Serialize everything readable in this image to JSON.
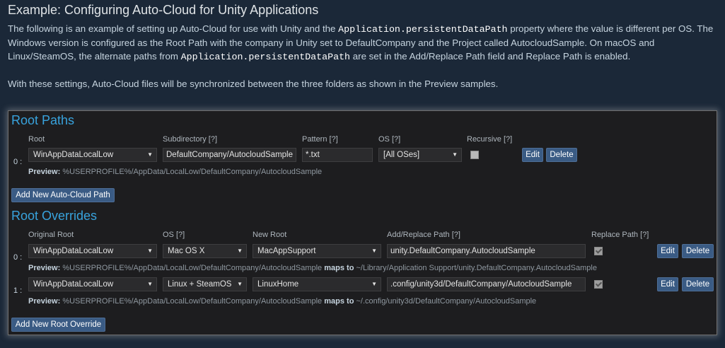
{
  "heading": "Example: Configuring Auto-Cloud for Unity Applications",
  "description": {
    "p1_part1": "The following is an example of setting up Auto-Cloud for use with Unity and the ",
    "p1_code1": "Application.persistentDataPath",
    "p1_part2": " property where the value is different per OS. The Windows version is configured as the Root Path with the company in Unity set to DefaultCompany and the Project called AutocloudSample. On macOS and Linux/SteamOS, the alternate paths from ",
    "p1_code2": "Application.persistentDataPath",
    "p1_part3": " are set in the Add/Replace Path field and Replace Path is enabled.",
    "p2": "With these settings, Auto-Cloud files will be synchronized between the three folders as shown in the Preview samples."
  },
  "root_paths": {
    "title": "Root Paths",
    "headers": {
      "root": "Root",
      "subdirectory": "Subdirectory [?]",
      "pattern": "Pattern [?]",
      "os": "OS [?]",
      "recursive": "Recursive [?]"
    },
    "rows": [
      {
        "index": "0 :",
        "root": "WinAppDataLocalLow",
        "subdirectory": "DefaultCompany/AutocloudSample",
        "pattern": "*.txt",
        "os": "[All OSes]",
        "recursive": false,
        "edit_label": "Edit",
        "delete_label": "Delete",
        "preview_label": "Preview:",
        "preview_value": "%USERPROFILE%/AppData/LocalLow/DefaultCompany/AutocloudSample"
      }
    ],
    "add_button": "Add New Auto-Cloud Path"
  },
  "root_overrides": {
    "title": "Root Overrides",
    "headers": {
      "original_root": "Original Root",
      "os": "OS [?]",
      "new_root": "New Root",
      "add_replace_path": "Add/Replace Path [?]",
      "replace_path": "Replace Path [?]"
    },
    "rows": [
      {
        "index": "0 :",
        "original_root": "WinAppDataLocalLow",
        "os": "Mac OS X",
        "new_root": "MacAppSupport",
        "add_replace_path": "unity.DefaultCompany.AutocloudSample",
        "replace_path": true,
        "edit_label": "Edit",
        "delete_label": "Delete",
        "preview_label": "Preview:",
        "preview_source": "%USERPROFILE%/AppData/LocalLow/DefaultCompany/AutocloudSample",
        "maps_to": "maps to",
        "preview_target": "~/Library/Application Support/unity.DefaultCompany.AutocloudSample"
      },
      {
        "index": "1 :",
        "original_root": "WinAppDataLocalLow",
        "os": "Linux + SteamOS",
        "new_root": "LinuxHome",
        "add_replace_path": ".config/unity3d/DefaultCompany/AutocloudSample",
        "replace_path": true,
        "edit_label": "Edit",
        "delete_label": "Delete",
        "preview_label": "Preview:",
        "preview_source": "%USERPROFILE%/AppData/LocalLow/DefaultCompany/AutocloudSample",
        "maps_to": "maps to",
        "preview_target": "~/.config/unity3d/DefaultCompany/AutocloudSample"
      }
    ],
    "add_button": "Add New Root Override"
  },
  "icons": {
    "dropdown": "chevron-down-icon",
    "checkbox": "checkbox-icon"
  },
  "colors": {
    "page_bg": "#1b2838",
    "panel_bg": "#1d1d1f",
    "section_title": "#38a3dd",
    "button_bg": "#3a5b84"
  }
}
